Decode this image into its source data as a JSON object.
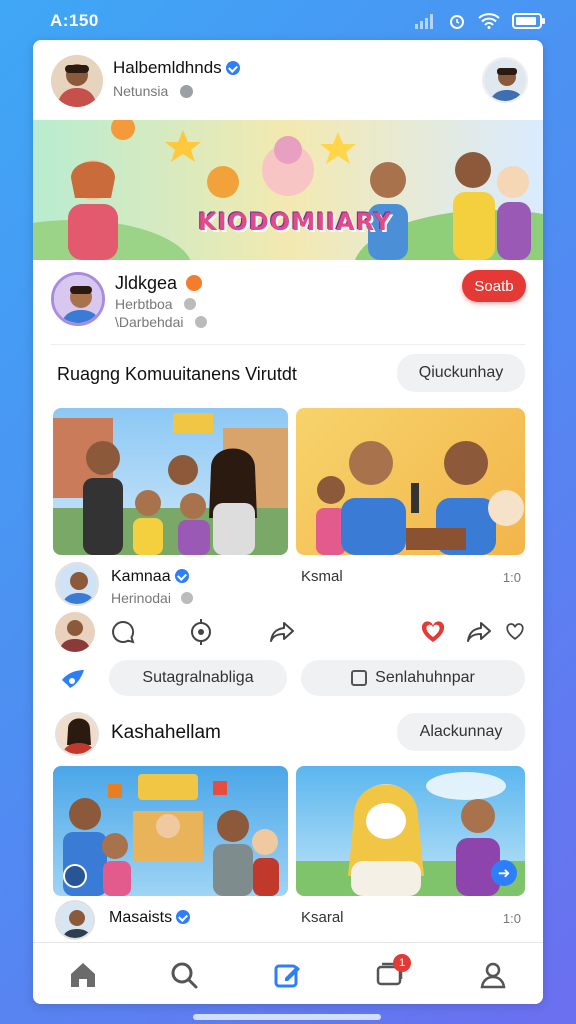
{
  "status": {
    "time": "A:150"
  },
  "header": {
    "name": "Halbemldhnds",
    "subtitle": "Netunsia"
  },
  "banner": {
    "title": "KIODOMIIARY"
  },
  "profile": {
    "name": "Jldkgea",
    "line1": "Herbtboa",
    "line2": "\\Darbehdai",
    "follow_label": "Soatb"
  },
  "community": {
    "heading": "Ruagng Komuuitanens Virutdt",
    "quick_label": "Qiuckunhay"
  },
  "post1": {
    "author": "Kamnaa",
    "author_sub": "Herinodai",
    "tag": "Ksmal",
    "count": "1:0",
    "share_left": "Sutagralnabliga",
    "share_right": "Senlahuhnpar"
  },
  "post2": {
    "author": "Kashahellam",
    "button": "Alackunnay",
    "footer_author": "Masaists",
    "footer_tag": "Ksaral",
    "footer_count": "1:0"
  },
  "nav": {
    "items": [
      "home",
      "search",
      "create",
      "notifications",
      "profile"
    ],
    "notification_badge": "1"
  },
  "colors": {
    "accent_red": "#e53935",
    "verified": "#2d7ff9",
    "nav_active": "#2d7ff9"
  }
}
